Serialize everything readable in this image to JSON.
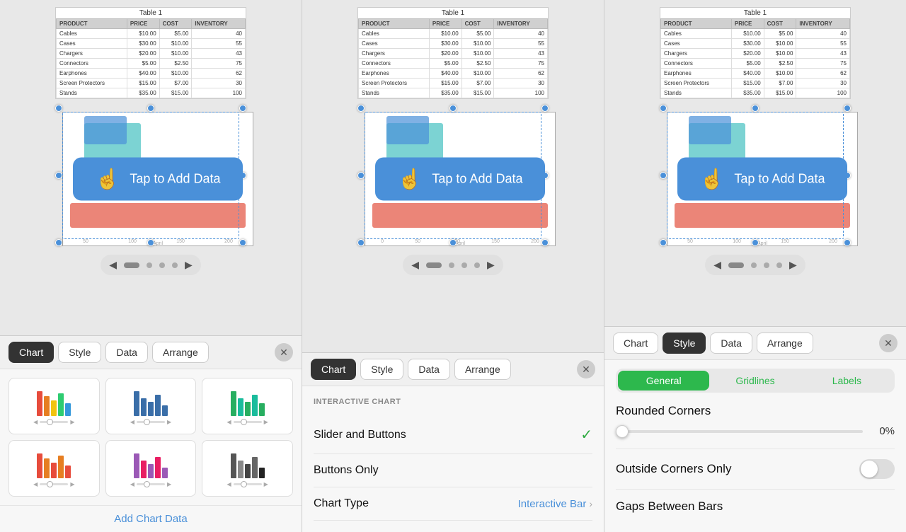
{
  "table": {
    "title": "Table 1",
    "headers": [
      "PRODUCT",
      "PRICE",
      "COST",
      "INVENTORY"
    ],
    "rows": [
      [
        "Cables",
        "$10.00",
        "$5.00",
        "40"
      ],
      [
        "Cases",
        "$30.00",
        "$10.00",
        "55"
      ],
      [
        "Chargers",
        "$20.00",
        "$10.00",
        "43"
      ],
      [
        "Connectors",
        "$5.00",
        "$2.50",
        "75"
      ],
      [
        "Earphones",
        "$40.00",
        "$10.00",
        "62"
      ],
      [
        "Screen Protectors",
        "$15.00",
        "$7.00",
        "30"
      ],
      [
        "Stands",
        "$35.00",
        "$15.00",
        "100"
      ]
    ]
  },
  "chart": {
    "tap_label": "Tap to Add Data"
  },
  "pagination": {
    "prev_label": "◀",
    "next_label": "▶"
  },
  "tabs": {
    "chart": "Chart",
    "style": "Style",
    "data": "Data",
    "arrange": "Arrange"
  },
  "panel1": {
    "active_tab": "chart",
    "add_chart_label": "Add Chart Data"
  },
  "panel2": {
    "active_tab": "chart",
    "section_label": "INTERACTIVE CHART",
    "options": [
      {
        "label": "Slider and Buttons",
        "selected": true
      },
      {
        "label": "Buttons Only",
        "selected": false
      }
    ],
    "chart_type_label": "Chart Type",
    "chart_type_value": "Interactive Bar"
  },
  "panel3": {
    "active_tab": "style",
    "style_tabs": [
      "General",
      "Gridlines",
      "Labels"
    ],
    "active_style_tab": "General",
    "rounded_corners_label": "Rounded Corners",
    "rounded_corners_value": "0%",
    "outside_corners_label": "Outside Corners Only",
    "outside_corners_enabled": false,
    "gaps_label": "Gaps Between Bars"
  },
  "chart_types": [
    {
      "id": "bars-color",
      "colors": [
        "#e74c3c",
        "#e67e22",
        "#f1c40f",
        "#2ecc71",
        "#3498db"
      ]
    },
    {
      "id": "bars-blue",
      "colors": [
        "#4a90d9",
        "#5ba8f0",
        "#3d7fc7"
      ]
    },
    {
      "id": "bars-green",
      "colors": [
        "#2ecc71",
        "#27ae60",
        "#1abc9c"
      ]
    },
    {
      "id": "bars-red",
      "colors": [
        "#e74c3c",
        "#e67e22",
        "#f39c12"
      ]
    },
    {
      "id": "bars-purple",
      "colors": [
        "#9b59b6",
        "#8e44ad",
        "#e91e63"
      ]
    },
    {
      "id": "bars-gray",
      "colors": [
        "#95a5a6",
        "#7f8c8d",
        "#bdc3c7"
      ]
    }
  ]
}
